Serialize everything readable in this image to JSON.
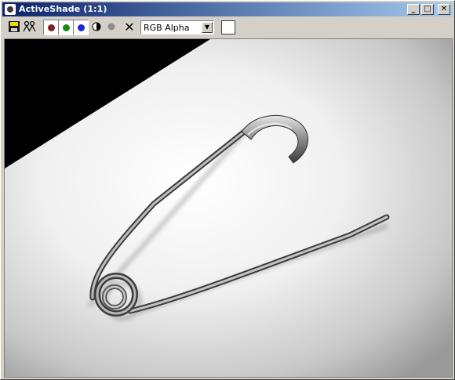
{
  "window": {
    "title": "ActiveShade (1:1)",
    "min_glyph": "_",
    "max_glyph": "□",
    "close_glyph": "✕"
  },
  "toolbar": {
    "channel_dropdown": {
      "selected": "RGB Alpha",
      "arrow": "▼"
    },
    "clear_glyph": "✕",
    "channels": [
      {
        "name": "red-channel",
        "color": "#7a2020"
      },
      {
        "name": "green-channel",
        "color": "#1a8a1a"
      },
      {
        "name": "blue-channel",
        "color": "#1a28d8"
      }
    ],
    "swatch_color": "#ffffff"
  },
  "viewport": {
    "subject": "safety pin on a white surface",
    "background": "#000000"
  }
}
